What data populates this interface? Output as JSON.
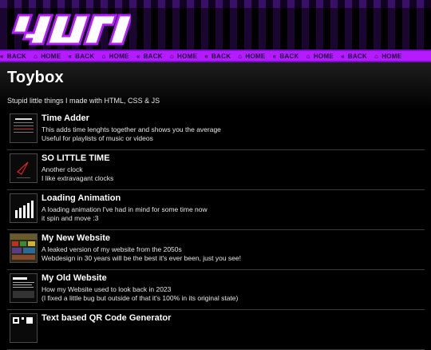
{
  "header": {
    "logo_alt": "yuri",
    "nav": [
      {
        "label": "BACK",
        "icon": "chevrons-left-icon"
      },
      {
        "label": "HOME",
        "icon": "home-icon"
      },
      {
        "label": "BACK",
        "icon": "chevrons-left-icon"
      },
      {
        "label": "HOME",
        "icon": "home-icon"
      },
      {
        "label": "BACK",
        "icon": "chevrons-left-icon"
      },
      {
        "label": "HOME",
        "icon": "home-icon"
      },
      {
        "label": "BACK",
        "icon": "chevrons-left-icon"
      },
      {
        "label": "HOME",
        "icon": "home-icon"
      },
      {
        "label": "BACK",
        "icon": "chevrons-left-icon"
      },
      {
        "label": "HOME",
        "icon": "home-icon"
      },
      {
        "label": "BACK",
        "icon": "chevrons-left-icon"
      },
      {
        "label": "HOME",
        "icon": "home-icon"
      }
    ]
  },
  "page": {
    "title": "Toybox",
    "subtitle": "Stupid little things I made with HTML, CSS & JS"
  },
  "items": [
    {
      "title": "Time Adder",
      "d1": "This adds time lenghts together and shows you the average",
      "d2": "Useful for playlists of music or videos",
      "thumb": "time-adder"
    },
    {
      "title": "SO LITTLE TIME",
      "d1": "Another clock",
      "d2": "I like extravagant clocks",
      "thumb": "clock"
    },
    {
      "title": "Loading Animation",
      "d1": "A loading animation I've had in mind for some time now",
      "d2": "it spin and move :3",
      "thumb": "loading"
    },
    {
      "title": "My New Website",
      "d1": "A leaked version of my website from the 2050s",
      "d2": "Webdesign in 30 years will be the best it's ever been, just you see!",
      "thumb": "new-site"
    },
    {
      "title": "My Old Website",
      "d1": "How my Website used to look back in 2023",
      "d2": "(I fixed a little bug but outside of that it's 100% in its original state)",
      "thumb": "old-site"
    },
    {
      "title": "Text based QR Code Generator",
      "d1": "",
      "d2": "",
      "thumb": "qr"
    }
  ],
  "colors": {
    "accent": "#b51bff",
    "background": "#000000"
  }
}
